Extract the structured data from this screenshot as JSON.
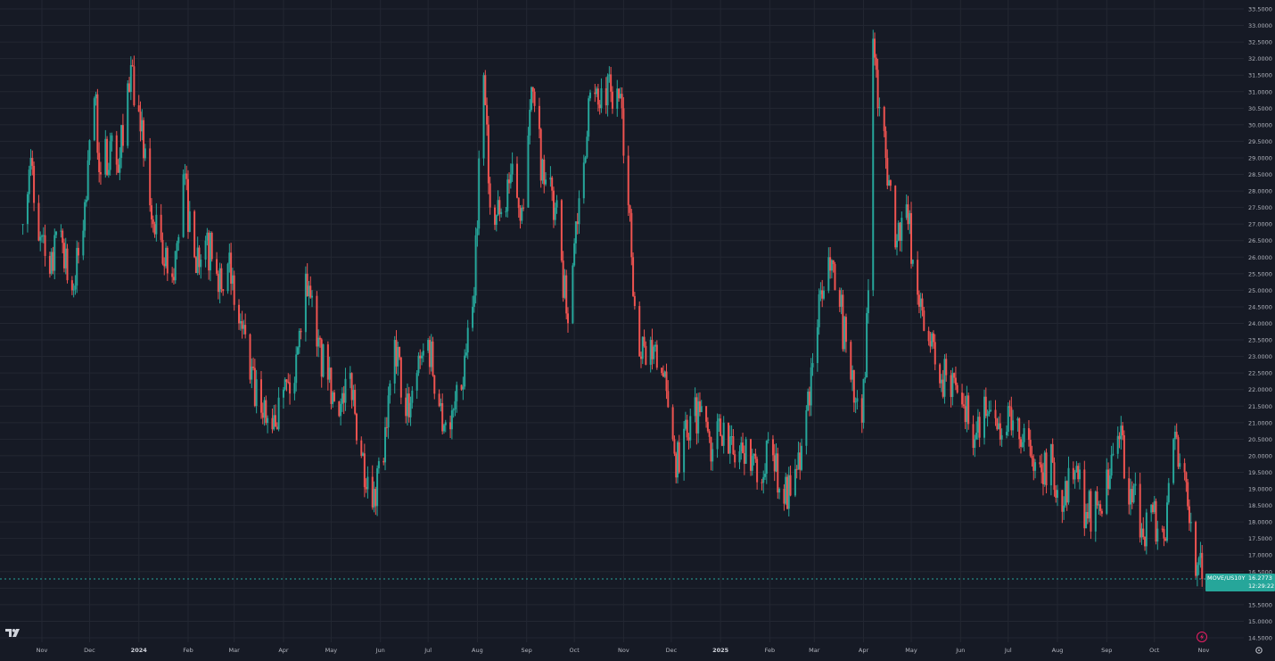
{
  "chart_data": {
    "type": "candlestick",
    "symbol": "MOVE/US10Y",
    "last_price": "16.2773",
    "countdown": "12:29:22",
    "y_range": [
      14.5,
      33.5
    ],
    "grid": true,
    "colors": {
      "background": "#161a25",
      "grid": "#232732",
      "up": "#26a69a",
      "down": "#ef5350",
      "axis_text": "#b2b5be",
      "label_bg": "#26a69a"
    },
    "y_ticks": [
      "14.5000",
      "15.0000",
      "15.5000",
      "16.0000",
      "16.5000",
      "17.0000",
      "17.5000",
      "18.0000",
      "18.5000",
      "19.0000",
      "19.5000",
      "20.0000",
      "20.5000",
      "21.0000",
      "21.5000",
      "22.0000",
      "22.5000",
      "23.0000",
      "23.5000",
      "24.0000",
      "24.5000",
      "25.0000",
      "25.5000",
      "26.0000",
      "26.5000",
      "27.0000",
      "27.5000",
      "28.0000",
      "28.5000",
      "29.0000",
      "29.5000",
      "30.0000",
      "30.5000",
      "31.0000",
      "31.5000",
      "32.0000",
      "32.5000",
      "33.0000",
      "33.5000"
    ],
    "x_ticks": [
      {
        "label": "Nov",
        "bold": false
      },
      {
        "label": "Dec",
        "bold": false
      },
      {
        "label": "2024",
        "bold": true
      },
      {
        "label": "Feb",
        "bold": false
      },
      {
        "label": "Mar",
        "bold": false
      },
      {
        "label": "Apr",
        "bold": false
      },
      {
        "label": "May",
        "bold": false
      },
      {
        "label": "Jun",
        "bold": false
      },
      {
        "label": "Jul",
        "bold": false
      },
      {
        "label": "Aug",
        "bold": false
      },
      {
        "label": "Sep",
        "bold": false
      },
      {
        "label": "Oct",
        "bold": false
      },
      {
        "label": "Nov",
        "bold": false
      },
      {
        "label": "Dec",
        "bold": false
      },
      {
        "label": "2025",
        "bold": true
      },
      {
        "label": "Feb",
        "bold": false
      },
      {
        "label": "Mar",
        "bold": false
      },
      {
        "label": "Apr",
        "bold": false
      },
      {
        "label": "May",
        "bold": false
      },
      {
        "label": "Jun",
        "bold": false
      },
      {
        "label": "Jul",
        "bold": false
      },
      {
        "label": "Aug",
        "bold": false
      },
      {
        "label": "Sep",
        "bold": false
      },
      {
        "label": "Oct",
        "bold": false
      },
      {
        "label": "Nov",
        "bold": false
      }
    ],
    "x_tick_dates": [
      "2023-11-01",
      "2023-12-01",
      "2024-01-01",
      "2024-02-01",
      "2024-03-01",
      "2024-04-01",
      "2024-05-01",
      "2024-06-01",
      "2024-07-01",
      "2024-08-01",
      "2024-09-01",
      "2024-10-01",
      "2024-11-01",
      "2024-12-01",
      "2025-01-01",
      "2025-02-01",
      "2025-03-01",
      "2025-04-01",
      "2025-05-01",
      "2025-06-01",
      "2025-07-01",
      "2025-08-01",
      "2025-09-01",
      "2025-10-01",
      "2025-11-01"
    ],
    "close_anchors": [
      [
        "2023-10-20",
        27.0
      ],
      [
        "2023-10-25",
        29.0
      ],
      [
        "2023-10-30",
        26.5
      ],
      [
        "2023-11-06",
        25.5
      ],
      [
        "2023-11-13",
        26.8
      ],
      [
        "2023-11-20",
        25.0
      ],
      [
        "2023-11-27",
        26.8
      ],
      [
        "2023-12-04",
        30.8
      ],
      [
        "2023-12-08",
        28.5
      ],
      [
        "2023-12-14",
        29.5
      ],
      [
        "2023-12-20",
        29.0
      ],
      [
        "2023-12-27",
        31.8
      ],
      [
        "2024-01-02",
        29.8
      ],
      [
        "2024-01-10",
        27.0
      ],
      [
        "2024-01-16",
        25.8
      ],
      [
        "2024-01-23",
        25.3
      ],
      [
        "2024-01-29",
        28.5
      ],
      [
        "2024-02-05",
        26.0
      ],
      [
        "2024-02-12",
        26.5
      ],
      [
        "2024-02-19",
        25.5
      ],
      [
        "2024-02-26",
        25.8
      ],
      [
        "2024-03-04",
        24.0
      ],
      [
        "2024-03-11",
        22.3
      ],
      [
        "2024-03-18",
        21.3
      ],
      [
        "2024-03-25",
        20.8
      ],
      [
        "2024-04-01",
        22.0
      ],
      [
        "2024-04-08",
        22.2
      ],
      [
        "2024-04-15",
        25.5
      ],
      [
        "2024-04-22",
        23.3
      ],
      [
        "2024-04-29",
        22.3
      ],
      [
        "2024-05-06",
        21.2
      ],
      [
        "2024-05-13",
        22.5
      ],
      [
        "2024-05-20",
        20.0
      ],
      [
        "2024-05-28",
        19.0
      ],
      [
        "2024-06-03",
        19.8
      ],
      [
        "2024-06-10",
        23.5
      ],
      [
        "2024-06-17",
        21.2
      ],
      [
        "2024-06-24",
        22.5
      ],
      [
        "2024-07-01",
        23.5
      ],
      [
        "2024-07-08",
        21.5
      ],
      [
        "2024-07-15",
        20.8
      ],
      [
        "2024-07-22",
        22.0
      ],
      [
        "2024-07-29",
        24.5
      ],
      [
        "2024-08-05",
        31.5
      ],
      [
        "2024-08-09",
        27.5
      ],
      [
        "2024-08-15",
        27.3
      ],
      [
        "2024-08-22",
        28.5
      ],
      [
        "2024-08-29",
        27.5
      ],
      [
        "2024-09-05",
        31.0
      ],
      [
        "2024-09-12",
        28.2
      ],
      [
        "2024-09-19",
        27.5
      ],
      [
        "2024-09-26",
        24.3
      ],
      [
        "2024-10-03",
        27.0
      ],
      [
        "2024-10-10",
        30.8
      ],
      [
        "2024-10-17",
        30.5
      ],
      [
        "2024-10-24",
        31.0
      ],
      [
        "2024-10-31",
        30.5
      ],
      [
        "2024-11-06",
        26.0
      ],
      [
        "2024-11-11",
        23.0
      ],
      [
        "2024-11-18",
        23.5
      ],
      [
        "2024-11-25",
        22.5
      ],
      [
        "2024-12-02",
        20.5
      ],
      [
        "2024-12-06",
        19.5
      ],
      [
        "2024-12-13",
        21.2
      ],
      [
        "2024-12-20",
        21.5
      ],
      [
        "2024-12-27",
        20.2
      ],
      [
        "2025-01-03",
        21.0
      ],
      [
        "2025-01-10",
        19.8
      ],
      [
        "2025-01-17",
        20.5
      ],
      [
        "2025-01-24",
        19.2
      ],
      [
        "2025-01-31",
        20.5
      ],
      [
        "2025-02-07",
        19.0
      ],
      [
        "2025-02-14",
        18.8
      ],
      [
        "2025-02-21",
        20.3
      ],
      [
        "2025-02-28",
        22.8
      ],
      [
        "2025-03-05",
        25.0
      ],
      [
        "2025-03-10",
        26.0
      ],
      [
        "2025-03-17",
        24.5
      ],
      [
        "2025-03-24",
        22.3
      ],
      [
        "2025-03-31",
        21.0
      ],
      [
        "2025-04-04",
        25.0
      ],
      [
        "2025-04-07",
        32.6
      ],
      [
        "2025-04-10",
        30.5
      ],
      [
        "2025-04-15",
        29.0
      ],
      [
        "2025-04-22",
        26.5
      ],
      [
        "2025-04-29",
        27.0
      ],
      [
        "2025-05-06",
        24.5
      ],
      [
        "2025-05-13",
        23.3
      ],
      [
        "2025-05-20",
        22.3
      ],
      [
        "2025-05-27",
        22.5
      ],
      [
        "2025-06-03",
        21.5
      ],
      [
        "2025-06-10",
        20.5
      ],
      [
        "2025-06-17",
        21.2
      ],
      [
        "2025-06-24",
        20.8
      ],
      [
        "2025-07-01",
        21.5
      ],
      [
        "2025-07-08",
        20.5
      ],
      [
        "2025-07-15",
        20.0
      ],
      [
        "2025-07-22",
        19.5
      ],
      [
        "2025-07-29",
        19.8
      ],
      [
        "2025-08-05",
        18.5
      ],
      [
        "2025-08-12",
        19.5
      ],
      [
        "2025-08-19",
        18.3
      ],
      [
        "2025-08-26",
        18.5
      ],
      [
        "2025-09-02",
        19.0
      ],
      [
        "2025-09-09",
        20.5
      ],
      [
        "2025-09-16",
        19.0
      ],
      [
        "2025-09-23",
        17.8
      ],
      [
        "2025-09-30",
        18.3
      ],
      [
        "2025-10-07",
        17.5
      ],
      [
        "2025-10-13",
        20.5
      ],
      [
        "2025-10-20",
        19.5
      ],
      [
        "2025-10-24",
        18.0
      ],
      [
        "2025-10-28",
        16.7
      ],
      [
        "2025-10-31",
        16.2773
      ]
    ]
  },
  "ui": {
    "brand_icon": "tradingview-logo-icon",
    "lightning_icon": "lightning-icon",
    "settings_icon": "gear-icon"
  }
}
